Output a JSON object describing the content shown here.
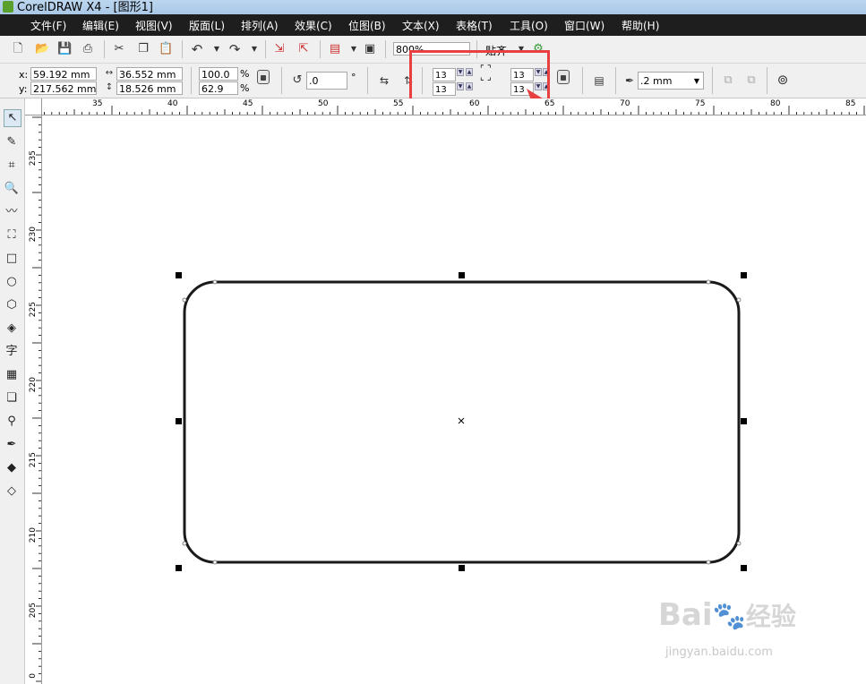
{
  "window": {
    "title": "CorelDRAW X4 - [图形1]"
  },
  "menu": [
    "文件(F)",
    "编辑(E)",
    "视图(V)",
    "版面(L)",
    "排列(A)",
    "效果(C)",
    "位图(B)",
    "文本(X)",
    "表格(T)",
    "工具(O)",
    "窗口(W)",
    "帮助(H)"
  ],
  "toolbar": {
    "zoom": "800%",
    "snap_label": "贴齐"
  },
  "property_bar": {
    "x_label": "x:",
    "x_value": "59.192 mm",
    "y_label": "y:",
    "y_value": "217.562 mm",
    "width_value": "36.552 mm",
    "height_value": "18.526 mm",
    "scale_x": "100.0",
    "scale_y": "62.9",
    "percent": "%",
    "rotation": ".0",
    "degree": "°",
    "corner_tl": "13",
    "corner_bl": "13",
    "corner_tr": "13",
    "corner_br": "13",
    "outline_width": ".2 mm"
  },
  "rulers": {
    "horizontal": [
      "35",
      "40",
      "45",
      "50",
      "55",
      "60",
      "65",
      "70",
      "75",
      "80",
      "85"
    ],
    "vertical": [
      "235",
      "230",
      "225",
      "220",
      "215",
      "210",
      "205",
      "0"
    ]
  },
  "watermark": {
    "brand": "Bai",
    "brand_cn": "经验",
    "url": "jingyan.baidu.com"
  },
  "colors": {
    "menu_bg": "#1e1e1e",
    "highlight": "#e84040",
    "shape_stroke": "#1a1a1a"
  }
}
